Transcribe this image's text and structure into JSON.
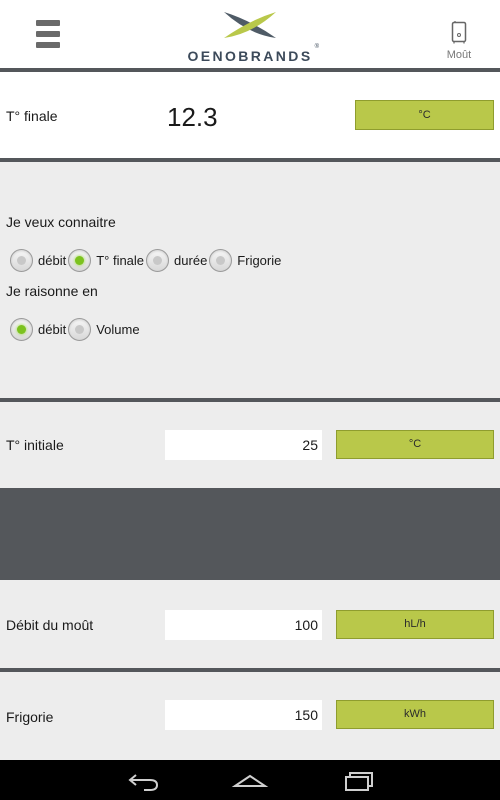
{
  "header": {
    "logo_text": "OENOBRANDS",
    "logo_reg": "®",
    "mout_label": "Moût",
    "colors": {
      "logo_green": "#b9c84a",
      "logo_grey": "#4f5b66"
    }
  },
  "final": {
    "label": "T° finale",
    "value": "12.3",
    "unit": "°C"
  },
  "options": {
    "know_title": "Je veux connaitre",
    "know_options": [
      {
        "label": "débit",
        "checked": false
      },
      {
        "label": "T° finale",
        "checked": true
      },
      {
        "label": "durée",
        "checked": false
      },
      {
        "label": "Frigorie",
        "checked": false
      }
    ],
    "reason_title": "Je raisonne en",
    "reason_options": [
      {
        "label": "débit",
        "checked": true
      },
      {
        "label": "Volume",
        "checked": false
      }
    ]
  },
  "initial": {
    "label": "T° initiale",
    "value": "25",
    "unit": "°C"
  },
  "debit": {
    "label": "Débit du moût",
    "value": "100",
    "unit": "hL/h"
  },
  "frigorie": {
    "label": "Frigorie",
    "value": "150",
    "unit": "kWh"
  },
  "navbar": {
    "icons": [
      "back-icon",
      "home-icon",
      "recent-apps-icon"
    ]
  },
  "colors": {
    "accent": "#b9c84a",
    "divider": "#54575b",
    "radio_checked": "#7cc21f",
    "panel": "#ededed"
  }
}
